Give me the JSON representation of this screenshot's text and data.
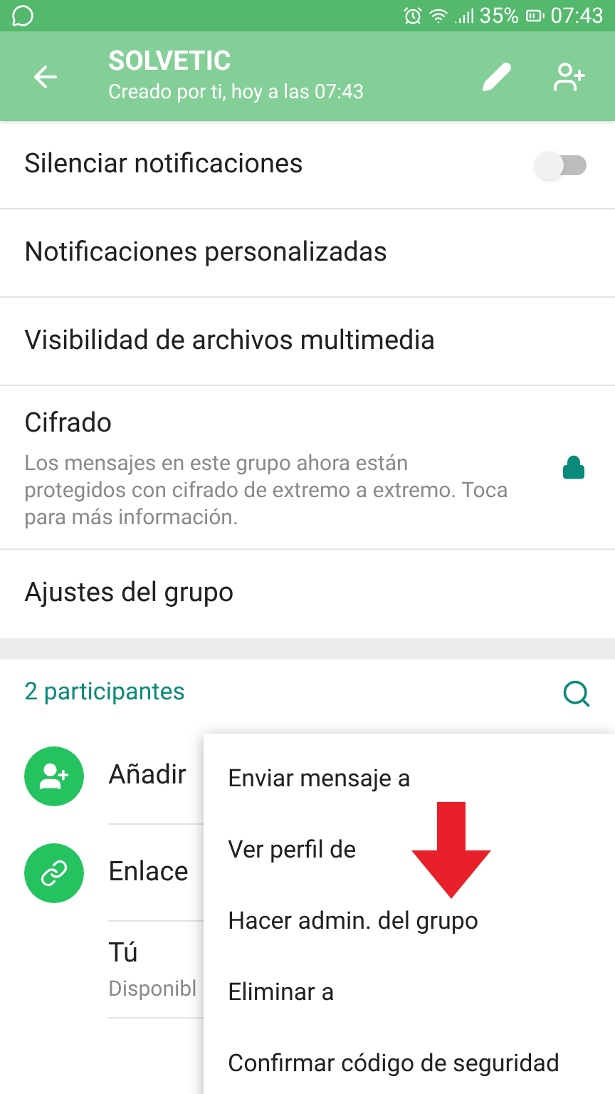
{
  "status_bar": {
    "battery": "35%",
    "time": "07:43"
  },
  "app_bar": {
    "title": "SOLVETIC",
    "subtitle": "Creado por ti, hoy a las 07:43"
  },
  "settings": [
    {
      "kind": "toggle",
      "label": "Silenciar notificaciones",
      "on": false
    },
    {
      "kind": "plain",
      "label": "Notificaciones personalizadas"
    },
    {
      "kind": "plain",
      "label": "Visibilidad de archivos multimedia"
    },
    {
      "kind": "lock",
      "label": "Cifrado",
      "description": "Los mensajes en este grupo ahora están protegidos con cifrado de extremo a extremo. Toca para más información."
    },
    {
      "kind": "plain",
      "label": "Ajustes del grupo"
    }
  ],
  "participants": {
    "header": "2 participantes",
    "items": [
      {
        "kind": "add",
        "label": "Añadir"
      },
      {
        "kind": "link",
        "label": "Enlace"
      },
      {
        "kind": "member",
        "label": "Tú",
        "status": "Disponibl"
      }
    ]
  },
  "context_menu": [
    "Enviar mensaje a",
    "Ver perfil de",
    "Hacer admin. del grupo",
    "Eliminar a",
    "Confirmar código de seguridad"
  ]
}
